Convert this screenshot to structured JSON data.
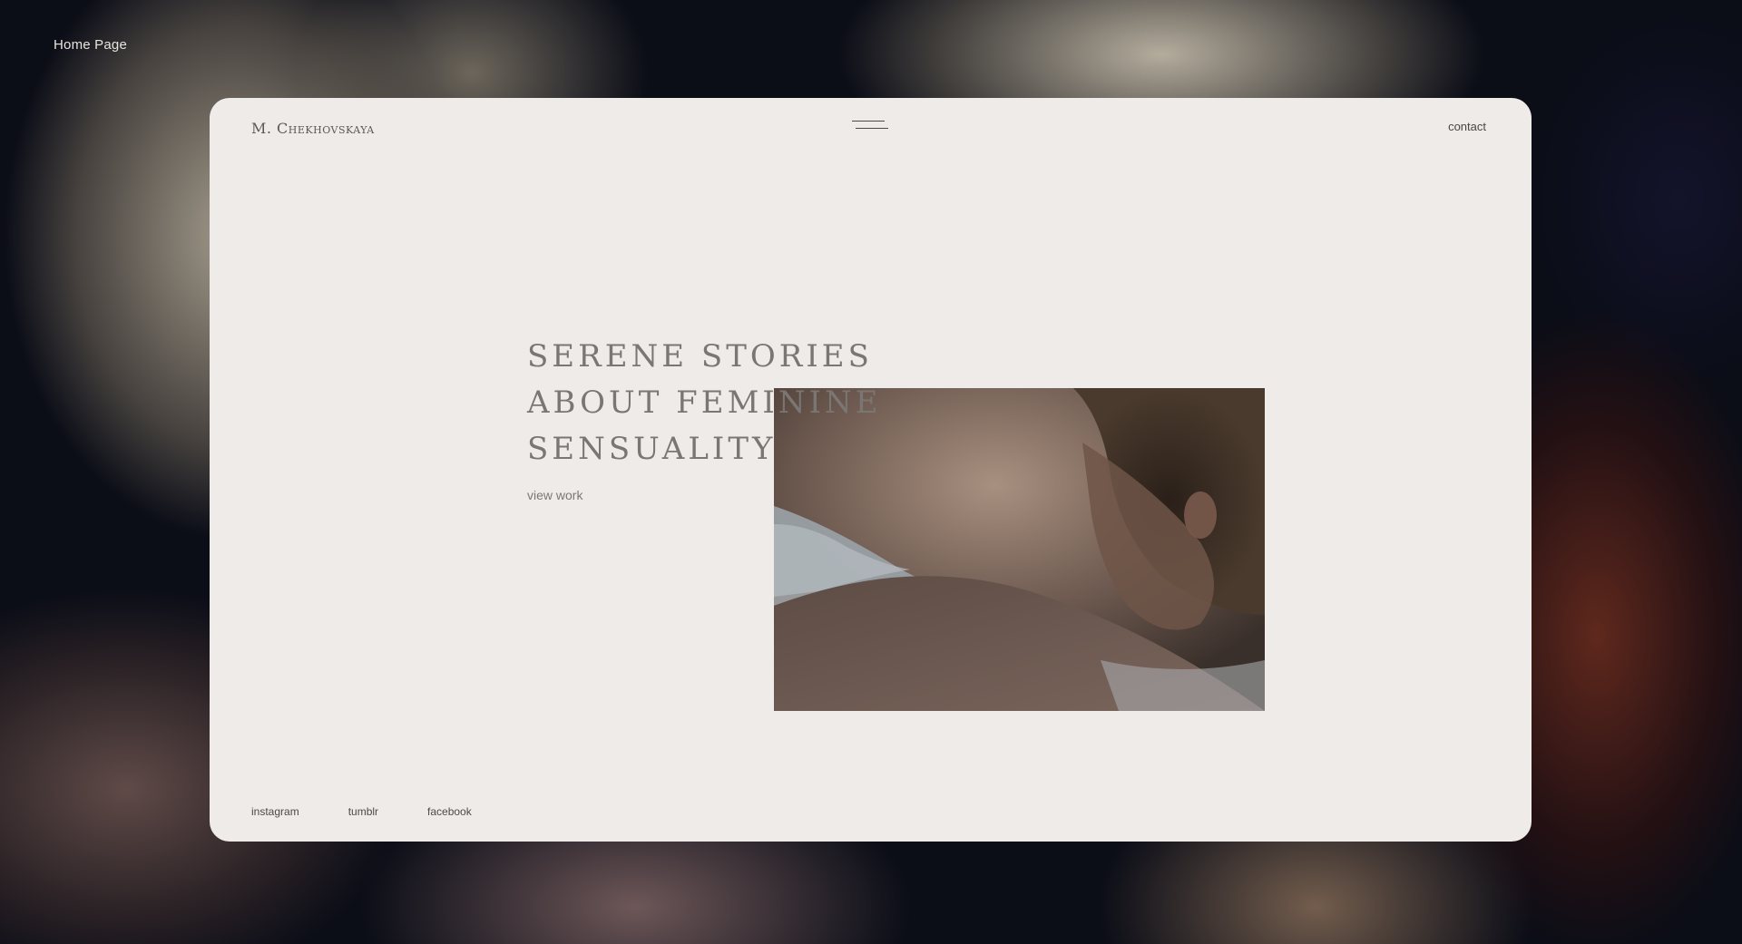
{
  "page": {
    "label": "Home Page"
  },
  "header": {
    "brand": "M. Chekhovskaya",
    "menu_icon": "hamburger-menu-icon",
    "contact_label": "contact"
  },
  "hero": {
    "headline_lines": [
      "SERENE STORIES",
      "ABOUT FEMININE",
      "SENSUALITY"
    ],
    "cta_label": "view work"
  },
  "footer": {
    "social_links": [
      "instagram",
      "tumblr",
      "facebook"
    ]
  }
}
